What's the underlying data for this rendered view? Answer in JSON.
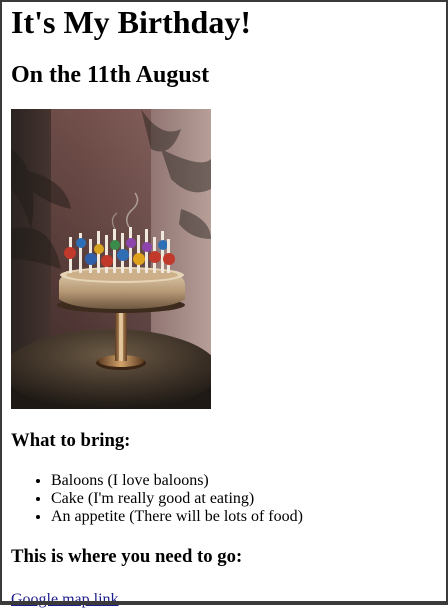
{
  "page": {
    "title": "It's My Birthday!",
    "date": "On the 11th August"
  },
  "image": {
    "icon": "birthday-cake-photo"
  },
  "bring": {
    "heading": "What to bring:",
    "items": [
      "Baloons (I love baloons)",
      "Cake (I'm really good at eating)",
      "An appetite (There will be lots of food)"
    ]
  },
  "location": {
    "heading": "This is where you need to go:",
    "link_text": "Google map link"
  }
}
